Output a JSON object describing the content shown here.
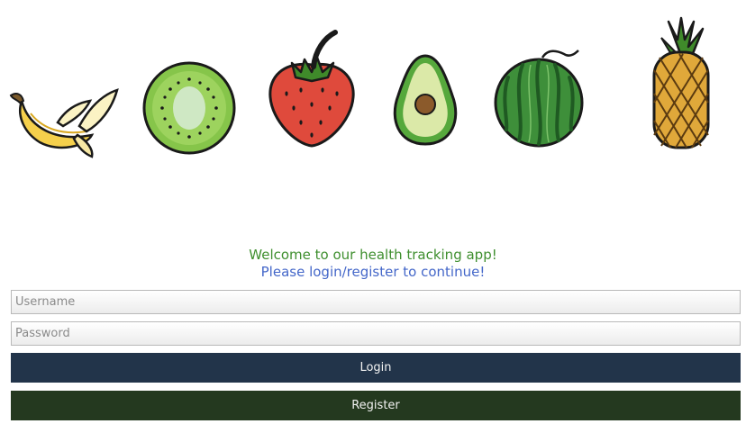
{
  "fruits": [
    "banana-icon",
    "kiwi-icon",
    "strawberry-icon",
    "avocado-icon",
    "watermelon-icon",
    "pineapple-icon"
  ],
  "welcome": {
    "line1": "Welcome to our health tracking app!",
    "line2": "Please login/register to continue!"
  },
  "form": {
    "username_placeholder": "Username",
    "password_placeholder": "Password",
    "username_value": "",
    "password_value": "",
    "login_label": "Login",
    "register_label": "Register"
  },
  "colors": {
    "welcome_text": "#3f8f2f",
    "prompt_text": "#4467c9",
    "login_button": "#22344a",
    "register_button": "#24391f"
  }
}
